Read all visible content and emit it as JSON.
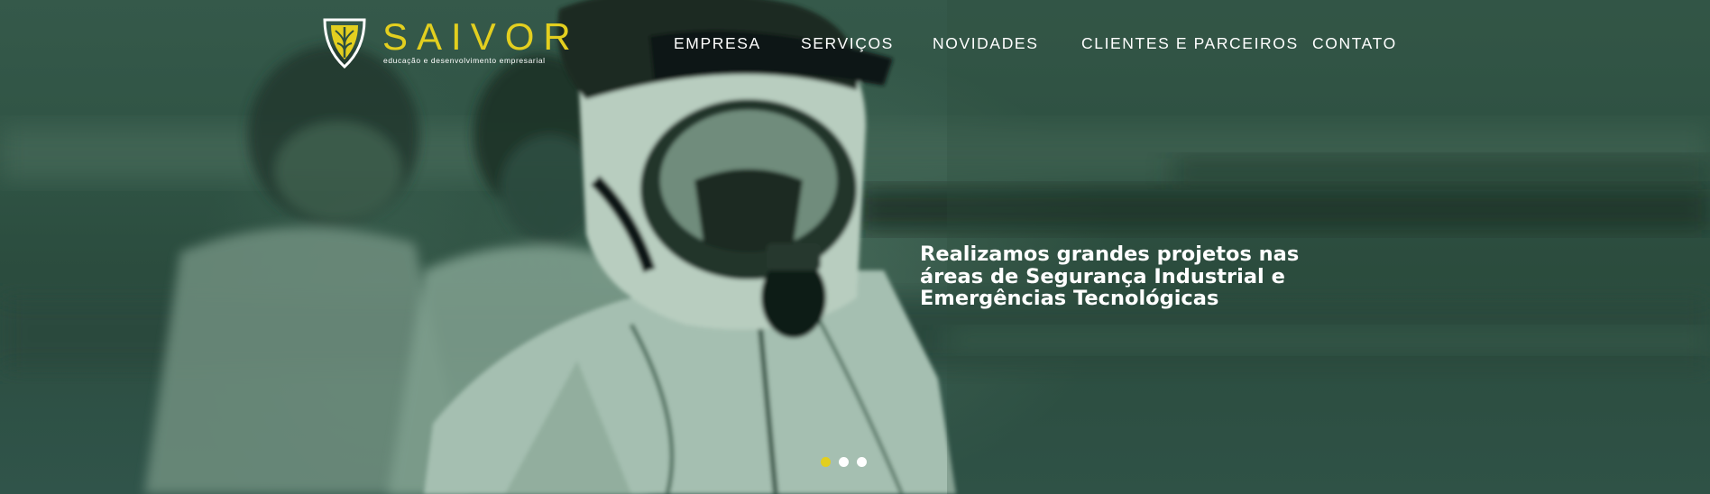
{
  "brand": {
    "name": "SAIVOR",
    "tagline": "educação e desenvolvimento empresarial",
    "accent_color": "#e3cf1f",
    "icon": "shield-emblem-icon"
  },
  "nav": {
    "items": [
      {
        "label": "EMPRESA"
      },
      {
        "label": "SERVIÇOS"
      },
      {
        "label": "NOVIDADES"
      },
      {
        "label": "CLIENTES E PARCEIROS"
      },
      {
        "label": "CONTATO"
      }
    ]
  },
  "hero": {
    "overlay_color": "#2c4f3f",
    "headline_lines": [
      "Realizamos grandes projetos nas",
      "áreas de Segurança Industrial e",
      "Emergências Tecnológicas"
    ]
  },
  "slider": {
    "active_index": 0,
    "count": 3,
    "active_color": "#e3cf1f",
    "inactive_color": "#ffffff"
  }
}
